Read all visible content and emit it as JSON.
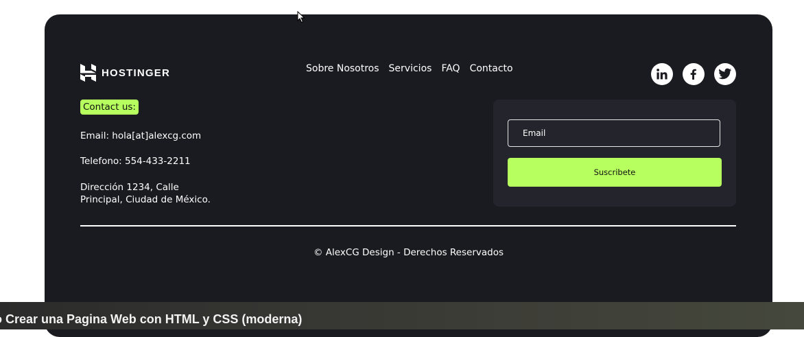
{
  "brand": {
    "name": "HOSTINGER",
    "icon": "hostinger-logo-icon"
  },
  "nav": {
    "items": [
      {
        "label": "Sobre Nosotros"
      },
      {
        "label": "Servicios"
      },
      {
        "label": "FAQ"
      },
      {
        "label": "Contacto"
      }
    ]
  },
  "socials": [
    {
      "icon": "linkedin-icon"
    },
    {
      "icon": "facebook-icon"
    },
    {
      "icon": "twitter-icon"
    }
  ],
  "contact": {
    "badge": "Contact us:",
    "email": "Email: hola[at]alexcg.com",
    "phone": "Telefono: 554-433-2211",
    "address": "Dirección 1234, Calle Principal, Ciudad de México."
  },
  "subscribe": {
    "placeholder": "Email",
    "button_label": "Suscribete"
  },
  "copyright": "© AlexCG Design - Derechos Reservados",
  "video": {
    "title": "o Crear una Pagina Web con HTML y CSS (moderna)"
  },
  "colors": {
    "background": "#1a1a21",
    "panel": "#24252c",
    "accent": "#b6ff5e",
    "text": "#ffffff"
  }
}
